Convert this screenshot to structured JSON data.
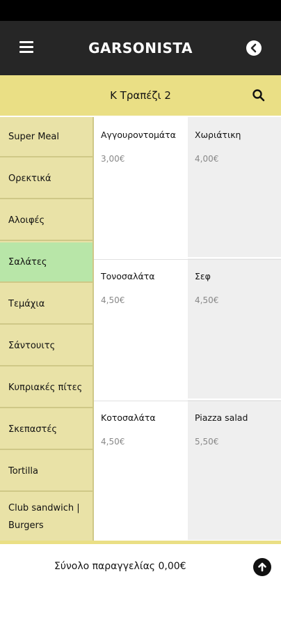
{
  "app": {
    "title": "GARSONISTA",
    "menu_icon": "hamburger-menu-icon",
    "back_icon": "back-circle-icon"
  },
  "table_bar": {
    "title": "Κ Τραπέζι 2",
    "search_icon": "search-icon"
  },
  "categories": [
    {
      "label": "Super Meal"
    },
    {
      "label": "Ορεκτικά"
    },
    {
      "label": "Αλοιφές"
    },
    {
      "label": "Σαλάτες",
      "active": true
    },
    {
      "label": "Τεμάχια"
    },
    {
      "label": "Σάντουιτς"
    },
    {
      "label": "Κυπριακές πίτες"
    },
    {
      "label": "Σκεπαστές"
    },
    {
      "label": "Tortilla"
    },
    {
      "label": "Club sandwich | Burgers"
    }
  ],
  "products": [
    {
      "name": "Αγγουροντομάτα",
      "price": "3,00€"
    },
    {
      "name": "Χωριάτικη",
      "price": "4,00€"
    },
    {
      "name": "Τονοσαλάτα",
      "price": "4,50€"
    },
    {
      "name": "Σεφ",
      "price": "4,50€"
    },
    {
      "name": "Κοτοσαλάτα",
      "price": "4,50€"
    },
    {
      "name": "Piazza salad",
      "price": "5,50€"
    }
  ],
  "footer": {
    "total_label": "Σύνολο παραγγελίας 0,00€",
    "up_icon": "arrow-up-circle-icon"
  },
  "colors": {
    "app_bar": "#262626",
    "accent_yellow": "#eadf85",
    "sidebar": "#e9e2a7",
    "active_category": "#b8e6a8"
  }
}
